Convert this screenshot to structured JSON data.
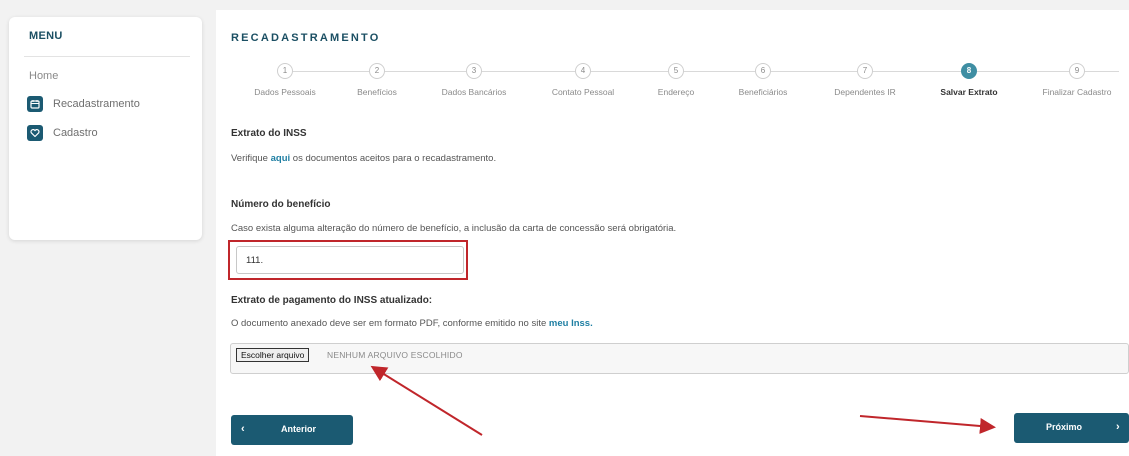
{
  "sidebar": {
    "title": "MENU",
    "home": "Home",
    "items": [
      {
        "label": "Recadastramento",
        "icon": "calendar-icon"
      },
      {
        "label": "Cadastro",
        "icon": "heart-icon"
      }
    ]
  },
  "main": {
    "title": "RECADASTRAMENTO",
    "steps": [
      {
        "number": "1",
        "label": "Dados Pessoais"
      },
      {
        "number": "2",
        "label": "Benefícios"
      },
      {
        "number": "3",
        "label": "Dados Bancários"
      },
      {
        "number": "4",
        "label": "Contato Pessoal"
      },
      {
        "number": "5",
        "label": "Endereço"
      },
      {
        "number": "6",
        "label": "Beneficiários"
      },
      {
        "number": "7",
        "label": "Dependentes IR"
      },
      {
        "number": "8",
        "label": "Salvar Extrato"
      },
      {
        "number": "9",
        "label": "Finalizar Cadastro"
      }
    ],
    "active_step": 8,
    "extrato": {
      "title": "Extrato do INSS",
      "text_before": "Verifique ",
      "link": "aqui",
      "text_after": " os documentos aceitos para o recadastramento."
    },
    "beneficio": {
      "title": "Número do benefício",
      "text": "Caso exista alguma alteração do número de benefício, a inclusão da carta de concessão será obrigatória.",
      "value": "111."
    },
    "pagamento": {
      "title": "Extrato de pagamento do INSS atualizado:",
      "text_before": "O documento anexado deve ser em formato PDF, conforme emitido no site ",
      "link": "meu Inss.",
      "file_button": "Escolher arquivo",
      "file_status": "NENHUM ARQUIVO ESCOLHIDO"
    },
    "prev_button": "Anterior",
    "next_button": "Próximo"
  },
  "colors": {
    "brand": "#1b5a72",
    "active_step": "#3f8ea3",
    "highlight_red": "#c0262b",
    "link": "#1f7fa3"
  }
}
